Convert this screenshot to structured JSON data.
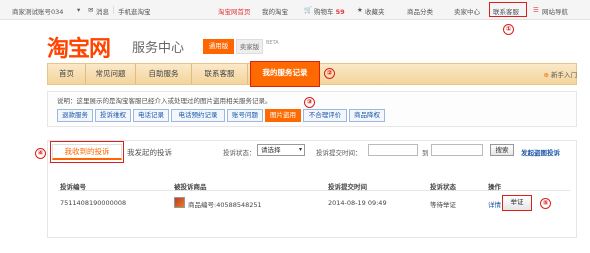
{
  "topbar": {
    "account": "商家测试账号034",
    "messages": "消息",
    "mobile": "手机逛淘宝",
    "home": "淘宝网首页",
    "my_taobao": "我的淘宝",
    "cart": "购物车",
    "cart_count": "59",
    "favorites": "收藏夹",
    "categories": "商品分类",
    "seller_center": "卖家中心",
    "contact_service": "联系客服",
    "site_nav": "网站导航"
  },
  "brand": {
    "logo": "淘宝网",
    "subtitle": "服务中心",
    "badge_general": "通用版",
    "badge_seller": "卖家版",
    "beta": "BETA"
  },
  "nav": {
    "items": [
      "首页",
      "常见问题",
      "自助服务",
      "联系客服",
      "我的服务记录"
    ],
    "newbie": "新手入门"
  },
  "notice": "说明：这里展示的是淘宝客服已经介入或处理过的图片盗用相关服务记录。",
  "record_tabs": [
    "退款服务",
    "投诉维权",
    "电话记录",
    "电话预约记录",
    "账号问题",
    "图片盗用",
    "不合理评价",
    "商品降权"
  ],
  "complaints": {
    "tab_received": "我收到的投诉",
    "tab_sent": "我发起的投诉",
    "status_label": "投诉状态：",
    "status_value": "请选择",
    "time_label": "投诉提交时间：",
    "to_label": "到",
    "search_button": "搜索",
    "initiate_link": "发起盗图投诉",
    "columns": [
      "投诉编号",
      "被投诉商品",
      "投诉提交时间",
      "投诉状态",
      "操作"
    ],
    "rows": [
      {
        "id": "7511408190000008",
        "product": "商品编号:40588548251",
        "time": "2014-08-19 09:49",
        "status": "等待举证",
        "detail": "详情",
        "action": "举证"
      }
    ]
  },
  "markers": [
    "①",
    "②",
    "③",
    "④",
    "⑤"
  ],
  "colors": {
    "brand_orange": "#ff6a00",
    "highlight_red": "#d9201a",
    "link_blue": "#1a55a8"
  }
}
